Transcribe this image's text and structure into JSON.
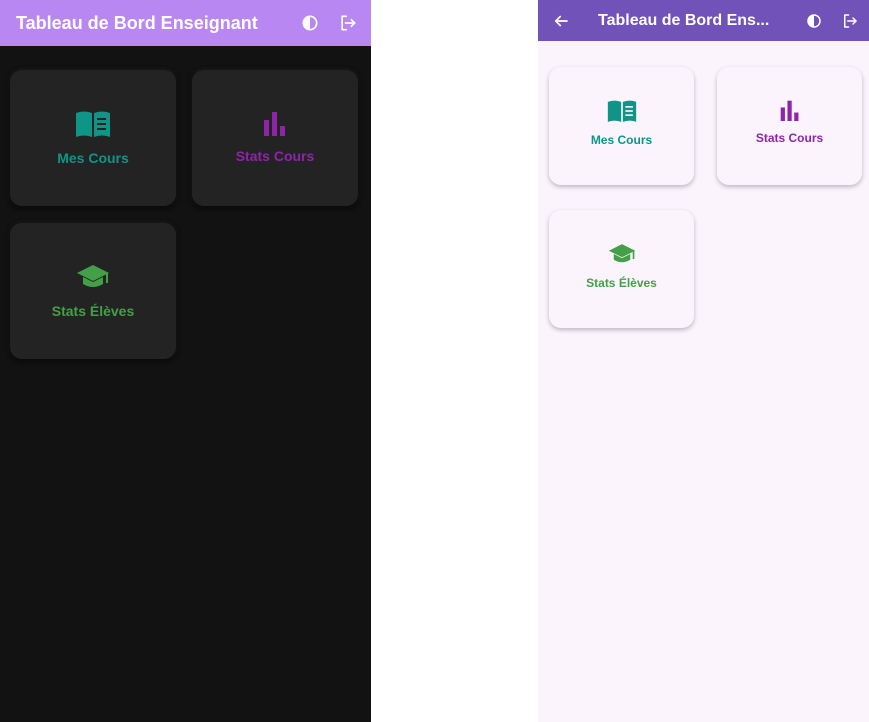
{
  "dark_screen": {
    "appbar": {
      "title": "Tableau de Bord Enseignant",
      "background": "#b987f2",
      "actions": [
        "theme-toggle-icon",
        "logout-icon"
      ]
    },
    "background": "#121212",
    "cards": [
      {
        "label": "Mes Cours",
        "icon": "book-icon",
        "color": "#0f9488"
      },
      {
        "label": "Stats Cours",
        "icon": "bar-chart-icon",
        "color": "#8e24aa"
      },
      {
        "label": "Stats Élèves",
        "icon": "graduation-cap-icon",
        "color": "#43a047"
      }
    ]
  },
  "light_screen": {
    "appbar": {
      "title": "Tableau de Bord Ens...",
      "background": "#7052b9",
      "leading": "back-arrow-icon",
      "actions": [
        "theme-toggle-icon",
        "logout-icon"
      ]
    },
    "background": "#fbf4fd",
    "cards": [
      {
        "label": "Mes Cours",
        "icon": "book-icon",
        "color": "#0f9488"
      },
      {
        "label": "Stats Cours",
        "icon": "bar-chart-icon",
        "color": "#8e24aa"
      },
      {
        "label": "Stats Élèves",
        "icon": "graduation-cap-icon",
        "color": "#43a047"
      }
    ]
  }
}
